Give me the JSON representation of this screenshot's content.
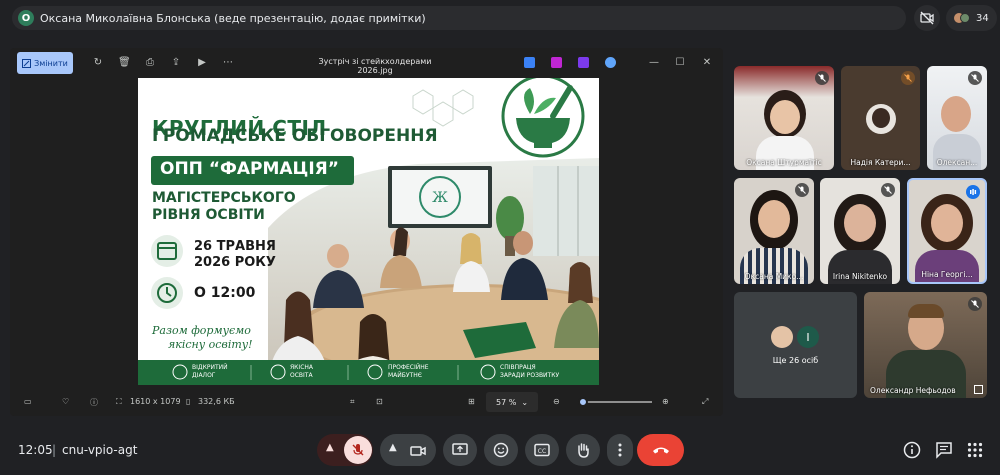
{
  "presenter": {
    "initial": "О",
    "text": "Оксана Миколаївна Блонська (веде презентацію, додає примітки)"
  },
  "top_right": {
    "participants_count": "34"
  },
  "viewer": {
    "edit_label": "Змінити",
    "file_name": "Зустріч зі стейкхолдерами 2026.jpg",
    "dimensions": "1610 x 1079",
    "file_size": "332,6 КБ",
    "zoom": "57 %"
  },
  "slide": {
    "title1": "КРУГЛИЙ СТІЛ",
    "title2": "ГРОМАДСЬКЕ ОБГОВОРЕННЯ",
    "program": "ОПП “ФАРМАЦІЯ”",
    "level1": "МАГІСТЕРСЬКОГО",
    "level2": "РІВНЯ ОСВІТИ",
    "date1": "26 ТРАВНЯ",
    "date2": "2026 РОКУ",
    "time": "О 12:00",
    "slogan1": "Разом формуємо",
    "slogan2": "якісну освіту!",
    "footer": [
      {
        "l1": "ВІДКРИТИЙ",
        "l2": "ДІАЛОГ"
      },
      {
        "l1": "ЯКІСНА",
        "l2": "ОСВІТА"
      },
      {
        "l1": "ПРОФЕСІЙНЕ",
        "l2": "МАЙБУТНЄ"
      },
      {
        "l1": "СПІВПРАЦЯ",
        "l2": "ЗАРАДИ РОЗВИТКУ"
      }
    ]
  },
  "participants": [
    {
      "name": "Оксана Штурмаїтіс"
    },
    {
      "name": "Надія Катери..."
    },
    {
      "name": "Олексан..."
    },
    {
      "name": "Оксана Мико..."
    },
    {
      "name": "Irina Nikitenko"
    },
    {
      "name": "Ніна Георгі..."
    },
    {
      "name": "Олександр Нефьодов"
    }
  ],
  "more_tile": {
    "label": "Ще 26 осіб",
    "initial": "І"
  },
  "bottom": {
    "time": "12:05",
    "separator": "|",
    "meeting_code": "cnu-vpio-agt"
  },
  "colors": {
    "accent_green": "#1e6b3a",
    "end_call_red": "#ea4335",
    "mic_off_bg": "#f9dedc",
    "edit_blue": "#a8c7fa"
  }
}
